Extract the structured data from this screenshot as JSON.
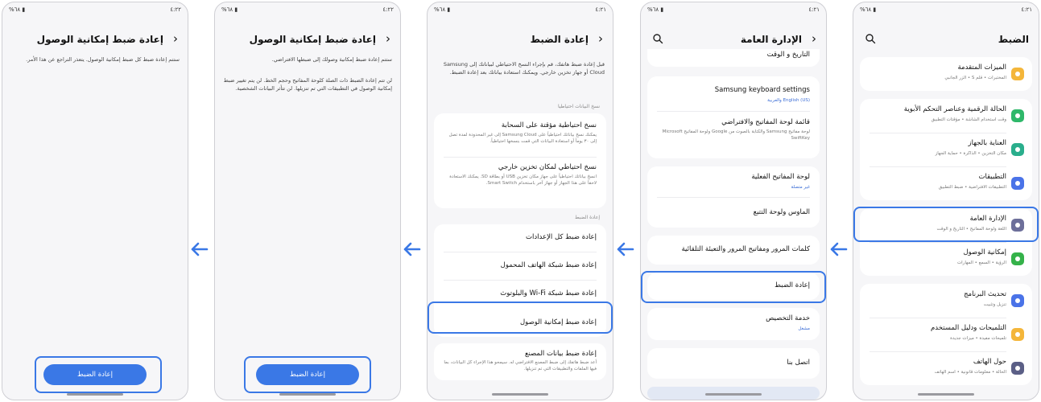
{
  "status_bar": {
    "left": "٤:٢٢",
    "right": "%٦٨ ▮",
    "left_2": "٤:٢١"
  },
  "screens": {
    "settings": {
      "title": "الضبط",
      "items": [
        {
          "title": "الميزات المتقدمة",
          "subtitle": "المختبرات • قلم S • الزر الجانبي",
          "color": "#f4b63a"
        },
        {
          "title": "الحالة الرقمية وعناصر التحكم الأبوية",
          "subtitle": "وقت استخدام الشاشة • مؤقتات التطبيق",
          "color": "#2fb86a"
        },
        {
          "title": "العناية بالجهاز",
          "subtitle": "مكان التخزين • الذاكرة • حماية الجهاز",
          "color": "#2aae8c"
        },
        {
          "title": "التطبيقات",
          "subtitle": "التطبيقات الافتراضية • ضبط التطبيق",
          "color": "#4a73e8"
        },
        {
          "title": "الإدارة العامة",
          "subtitle": "اللغة ولوحة المفاتيح • التاريخ و الوقت",
          "color": "#6d6f9a"
        },
        {
          "title": "إمكانية الوصول",
          "subtitle": "الرؤية • السمع • المهارات",
          "color": "#35b24a"
        },
        {
          "title": "تحديث البرنامج",
          "subtitle": "تنزيل وتثبيت",
          "color": "#4a73e8"
        },
        {
          "title": "التلميحات ودليل المستخدم",
          "subtitle": "تلميحات مفيدة • ميزات جديدة",
          "color": "#f4b63a"
        },
        {
          "title": "حول الهاتف",
          "subtitle": "الحالة • معلومات قانونية • اسم الهاتف",
          "color": "#5b5f86"
        }
      ]
    },
    "general": {
      "title": "الإدارة العامة",
      "top_cut": "التاريخ و الوقت",
      "items": [
        {
          "title": "Samsung keyboard settings",
          "subtitle": "English (US) والعربية",
          "blue": true
        },
        {
          "title": "قائمة لوحة المفاتيح والافتراضي",
          "subtitle": "لوحة مفاتيح Samsung والكتابة بالصوت من Google ولوحة المفاتيح Microsoft SwiftKey",
          "blue": false
        },
        {
          "title": "لوحة المفاتيح الفعلية",
          "subtitle": "غير متصلة",
          "blue": true
        },
        {
          "title": "الماوس ولوحة التتبع",
          "subtitle": "",
          "blue": false
        },
        {
          "title": "كلمات المرور ومفاتيح المرور والتعبئة التلقائية",
          "subtitle": "",
          "blue": false
        },
        {
          "title": "إعادة الضبط",
          "subtitle": "",
          "blue": false
        },
        {
          "title": "خدمة التخصيص",
          "subtitle": "مشغل",
          "blue": true
        },
        {
          "title": "اتصل بنا",
          "subtitle": "",
          "blue": false
        }
      ]
    },
    "reset": {
      "title": "إعادة الضبط",
      "description": "قبل إعادة ضبط هاتفك، قم بإجراء النسخ الاحتياطي لبياناتك إلى Samsung Cloud أو جهاز تخزين خارجي. ويمكنك استعادة بياناتك بعد إعادة الضبط.",
      "backup_header": "نسخ البيانات احتياطيا",
      "backup_items": [
        {
          "title": "نسخ احتياطية مؤقتة على السحابة",
          "subtitle": "يمكنك نسخ بياناتك احتياطياً على Samsung Cloud إلى غير المحدودة لمدة تصل إلى ٣٠ يوماً أو استعادة البيانات التي قمت بنسخها احتياطياً."
        },
        {
          "title": "نسخ احتياطي لمكان تخزين خارجي",
          "subtitle": "انسخ بياناتك احتياطياً على جهاز مكان تخزين USB أو بطاقة SD. يمكنك الاستعادة لاحقاً على هذا الجهاز أو جهاز آخر باستخدام Smart Switch."
        }
      ],
      "reset_header": "إعادة الضبط",
      "reset_items": [
        "إعادة ضبط كل الإعدادات",
        "إعادة ضبط شبكة الهاتف المحمول",
        "إعادة ضبط شبكة Wi-Fi والبلوتوث",
        "إعادة ضبط إمكانية الوصول"
      ],
      "factory": {
        "title": "إعادة ضبط بيانات المصنع",
        "subtitle": "أعد ضبط هاتفك إلى ضبط المصنع الافتراضي له. سيمحو هذا الإجراء كل البيانات، بما فيها الملفات والتطبيقات التي تم تنزيلها."
      }
    },
    "access_reset_full": {
      "title": "إعادة ضبط إمكانية الوصول",
      "paragraph1": "ستتم إعادة ضبط إمكانية وصولك إلى ضبطها الافتراضي.",
      "paragraph2": "لن تتم إعادة الضبط ذات الصلة كلوحة المفاتيح وحجم الخط. لن يتم تغيير ضبط إمكانية الوصول في التطبيقات التي تم تنزيلها. لن تتأثر البيانات الشخصية.",
      "button": "إعادة الضبط"
    },
    "access_reset_short": {
      "title": "إعادة ضبط إمكانية الوصول",
      "paragraph": "ستتم إعادة ضبط كل ضبط إمكانية الوصول. يتعذر التراجع عن هذا الأمر.",
      "button": "إعادة الضبط"
    }
  },
  "colors": {
    "accent": "#3a78e6",
    "background": "#f6f6f8",
    "card": "#ffffff"
  }
}
